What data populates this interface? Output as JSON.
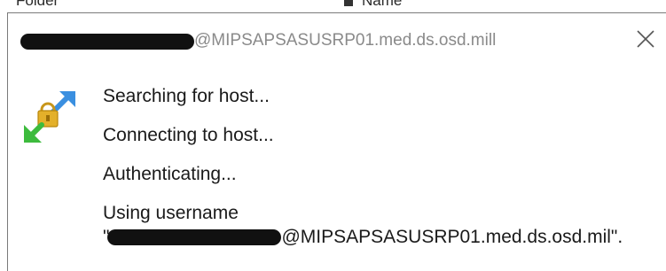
{
  "background": {
    "left_fragment": "Folder",
    "right_fragment": "Name"
  },
  "dialog": {
    "title_suffix": "@MIPSAPSASUSRP01.med.ds.osd.mill",
    "close_icon": "close-icon",
    "status_icon": "connection-lock-arrows-icon",
    "status_lines": [
      "Searching for host...",
      "Connecting to host...",
      "Authenticating...",
      "Using username"
    ],
    "username_quote_open": "\"",
    "username_suffix": "@MIPSAPSASUSRP01.med.ds.osd.mil\"."
  },
  "colors": {
    "title_text": "#8a8a8a",
    "body_text": "#1a1a1a",
    "arrow_blue": "#3a8fe0",
    "arrow_green": "#3dbb3d",
    "lock_gold": "#e3b02a",
    "redaction": "#111111"
  }
}
